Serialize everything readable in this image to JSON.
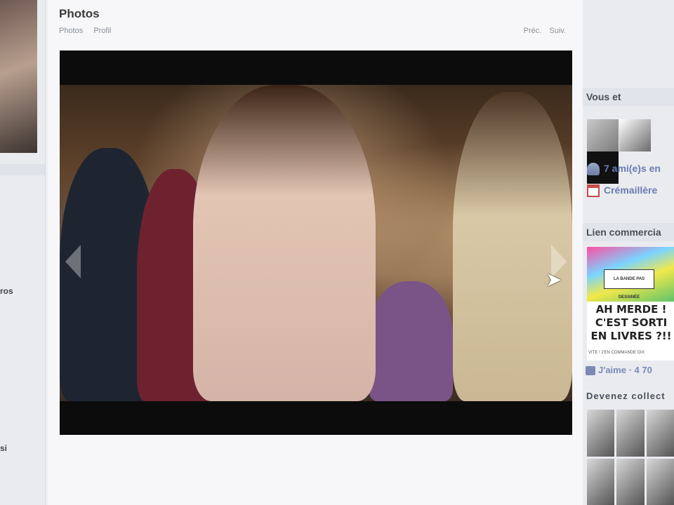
{
  "sidebar": {
    "items": [
      {
        "label": "ros"
      },
      {
        "label": "si"
      }
    ]
  },
  "main": {
    "title": "Photos",
    "subnav": [
      "Photos",
      "Profil"
    ],
    "pager": {
      "prev": "Préc.",
      "next": "Suiv."
    }
  },
  "right": {
    "you_and_header": "Vous et",
    "friends_text": "7 ami(e)s en",
    "event_text": "Crémaillère",
    "ads_header": "Lien commercia",
    "ad": {
      "badge": "LA BANDE PAS DESSINÉE",
      "line1": "AH MERDE !",
      "line2": "C'EST SORTI",
      "line3": "EN LIVRES ?!!",
      "small": "VITE ! J'EN COMMANDE DIX"
    },
    "like_label": "J'aime",
    "like_count": "4 70",
    "collect_header": "Devenez collect"
  }
}
